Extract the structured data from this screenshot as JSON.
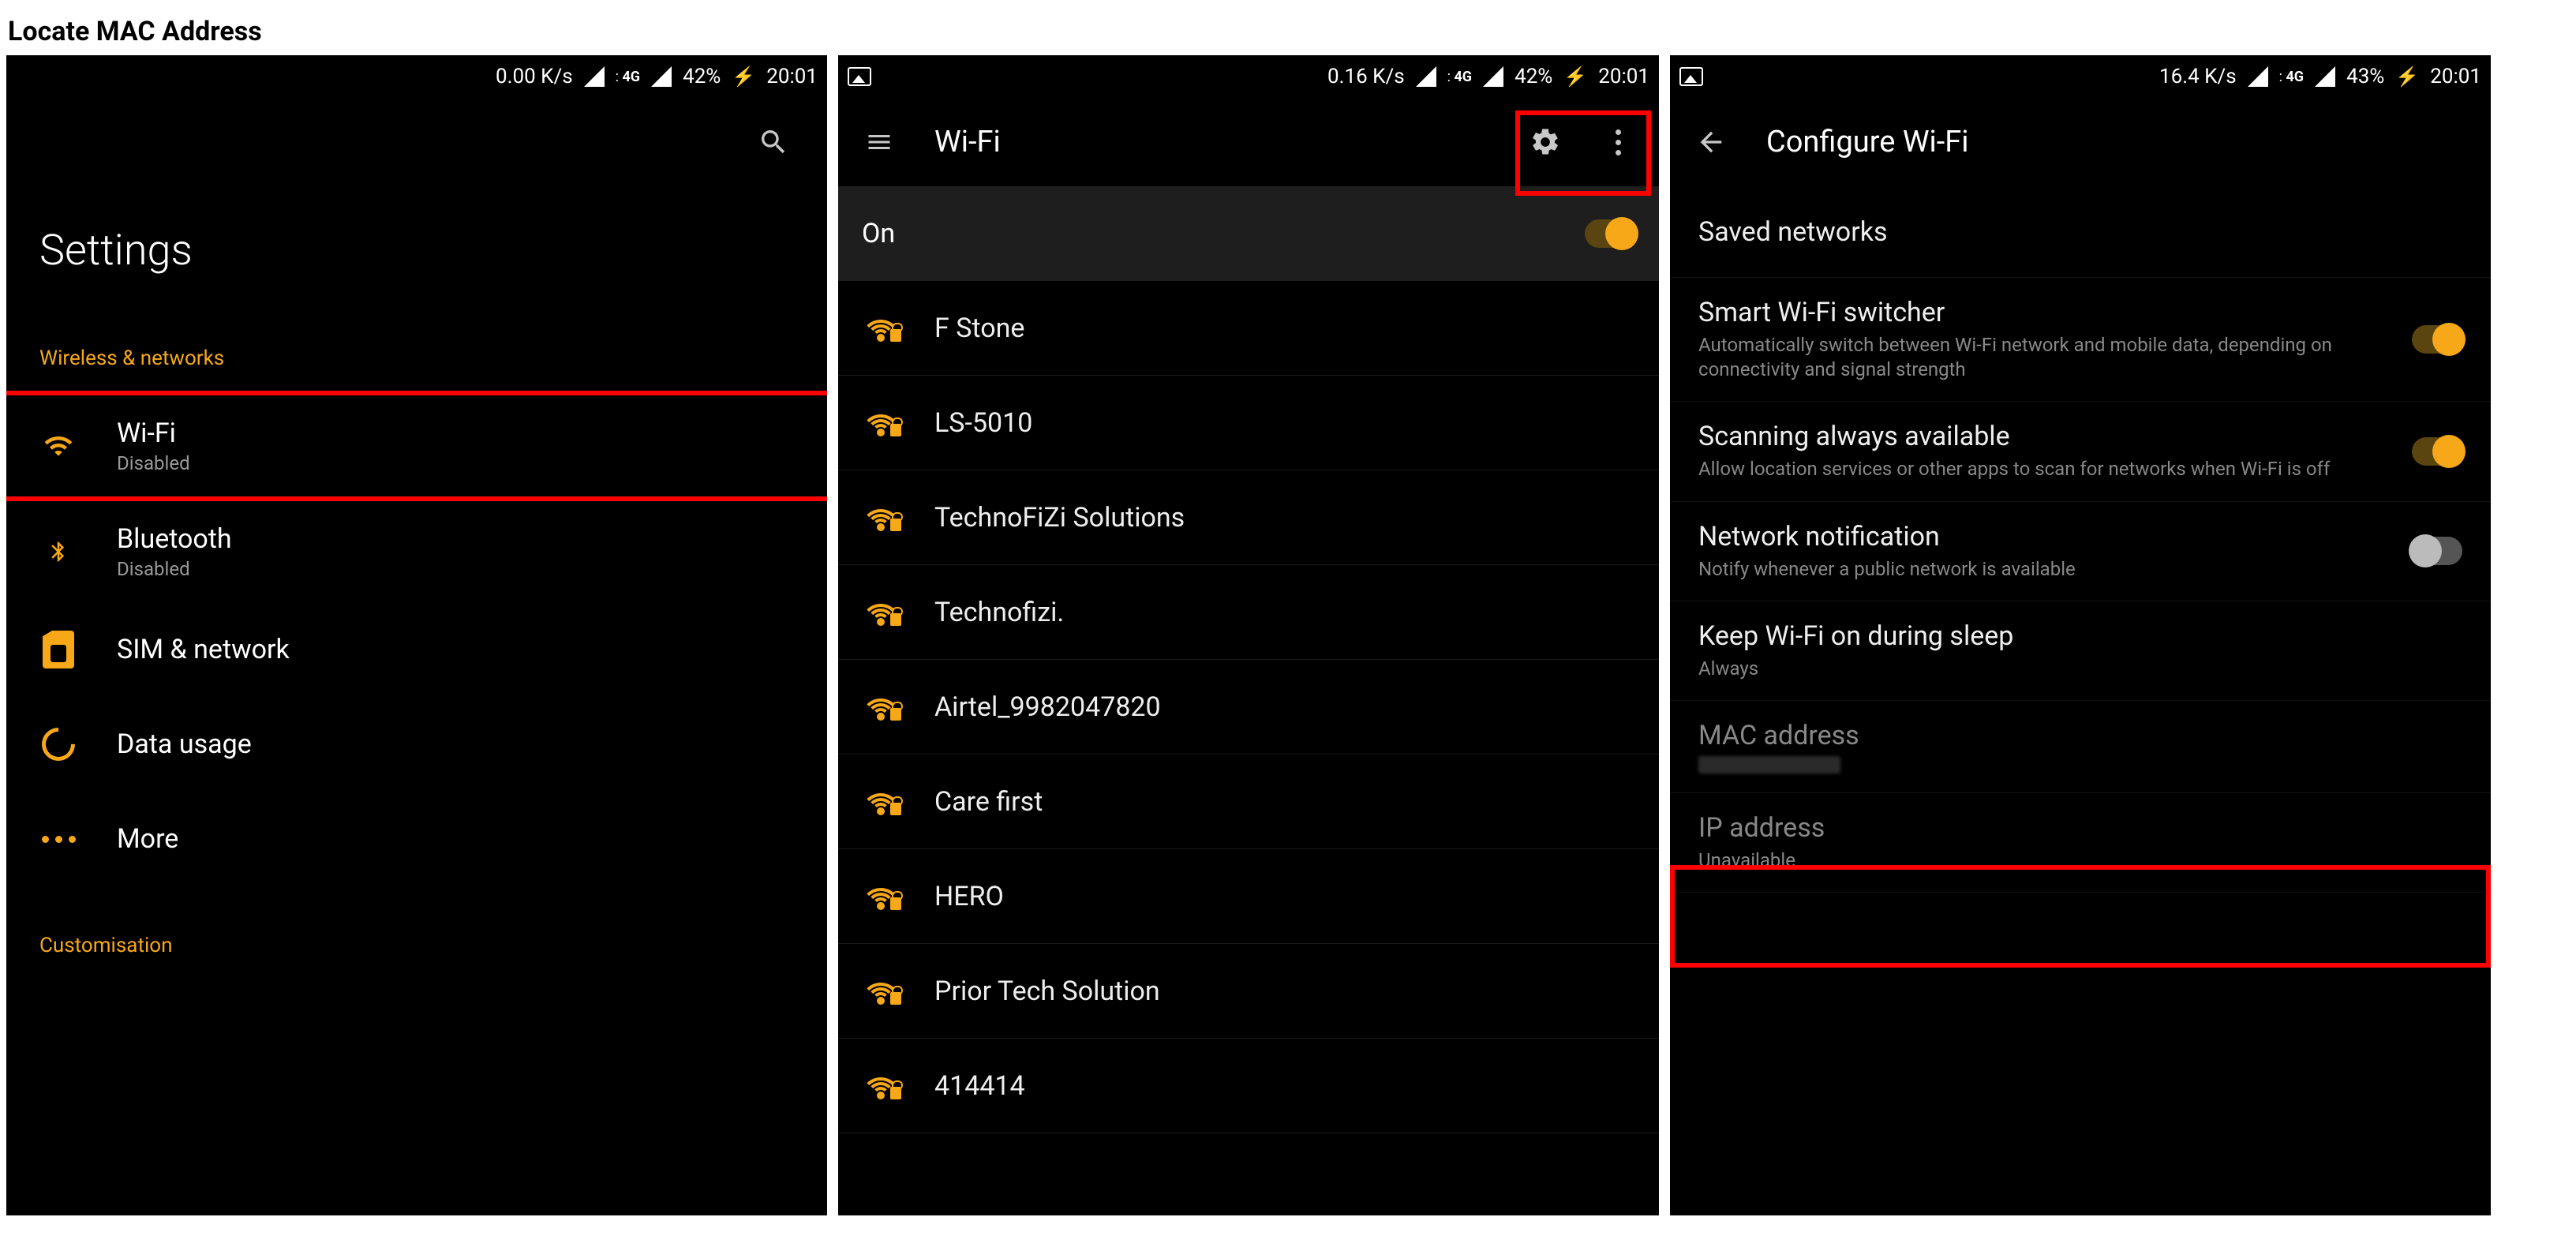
{
  "page_heading": "Locate MAC Address",
  "screens": {
    "settings": {
      "status": {
        "rate": "0.00 K/s",
        "net": "4G",
        "battery": "42%",
        "time": "20:01"
      },
      "title": "Settings",
      "section_wireless": "Wireless & networks",
      "rows": {
        "wifi": {
          "label": "Wi-Fi",
          "sub": "Disabled"
        },
        "bluetooth": {
          "label": "Bluetooth",
          "sub": "Disabled"
        },
        "sim": {
          "label": "SIM & network"
        },
        "data": {
          "label": "Data usage"
        },
        "more": {
          "label": "More"
        }
      },
      "section_custom": "Customisation"
    },
    "wifi": {
      "status": {
        "rate": "0.16 K/s",
        "net": "4G",
        "battery": "42%",
        "time": "20:01"
      },
      "header_title": "Wi-Fi",
      "on_label": "On",
      "networks": [
        "F Stone",
        "LS-5010",
        "TechnoFiZi Solutions",
        "Technofizi.",
        "Airtel_9982047820",
        "Care first",
        "HERO",
        "Prior Tech Solution",
        "414414"
      ]
    },
    "configure": {
      "status": {
        "rate": "16.4 K/s",
        "net": "4G",
        "battery": "43%",
        "time": "20:01"
      },
      "header_title": "Configure Wi-Fi",
      "rows": {
        "saved": {
          "title": "Saved networks"
        },
        "smart": {
          "title": "Smart Wi-Fi switcher",
          "sub": "Automatically switch between Wi-Fi network and mobile data, depending on connectivity and signal strength",
          "toggle": "on"
        },
        "scan": {
          "title": "Scanning always available",
          "sub": "Allow location services or other apps to scan for networks when Wi-Fi is off",
          "toggle": "on"
        },
        "notif": {
          "title": "Network notification",
          "sub": "Notify whenever a public network is available",
          "toggle": "off"
        },
        "sleep": {
          "title": "Keep Wi-Fi on during sleep",
          "sub": "Always"
        },
        "mac": {
          "title": "MAC address"
        },
        "ip": {
          "title": "IP address",
          "sub": "Unavailable"
        }
      }
    }
  }
}
